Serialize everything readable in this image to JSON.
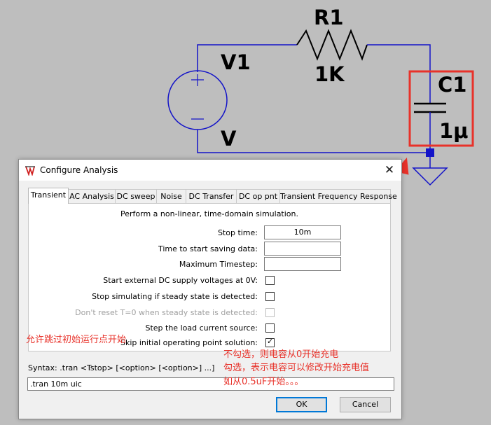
{
  "schematic": {
    "source_name": "V1",
    "source_value": "V",
    "resistor_name": "R1",
    "resistor_value": "1K",
    "capacitor_name": "C1",
    "capacitor_value": "1μ",
    "wire_color": "#1414c8",
    "highlight_color": "#e8322a"
  },
  "dialog": {
    "title": "Configure Analysis",
    "close_glyph": "✕",
    "tabs": [
      {
        "label": "Transient",
        "active": true
      },
      {
        "label": "AC Analysis"
      },
      {
        "label": "DC sweep"
      },
      {
        "label": "Noise"
      },
      {
        "label": "DC Transfer"
      },
      {
        "label": "DC op pnt"
      },
      {
        "label": "Transient Frequency Response"
      }
    ],
    "description": "Perform a non-linear, time-domain simulation.",
    "fields": {
      "stop_time": {
        "label": "Stop time:",
        "value": "10m"
      },
      "start_saving": {
        "label": "Time to start saving data:",
        "value": ""
      },
      "max_timestep": {
        "label": "Maximum Timestep:",
        "value": ""
      }
    },
    "options": {
      "start_dc_zero": {
        "label": "Start external DC supply voltages at 0V:",
        "checked": false
      },
      "stop_steady": {
        "label": "Stop simulating if steady state is detected:",
        "checked": false
      },
      "dont_reset": {
        "label": "Don't reset T=0 when steady state is detected:",
        "checked": false,
        "disabled": true
      },
      "step_load": {
        "label": "Step the load current source:",
        "checked": false
      },
      "skip_op": {
        "label": "Skip initial operating point solution:",
        "checked": true,
        "mark": "✓"
      }
    },
    "syntax_label": "Syntax:  .tran <Tstop> [<option> [<option>] ...]",
    "command": ".tran 10m uic",
    "ok_label": "OK",
    "cancel_label": "Cancel"
  },
  "annotations": {
    "skip_note": "允许跳过初始运行点开始",
    "bottom_note_1": "不勾选，则电容从0开始充电",
    "bottom_note_2": "勾选，表示电容可以修改开始充电值",
    "bottom_note_3": "如从0.5uF开始。。。"
  }
}
